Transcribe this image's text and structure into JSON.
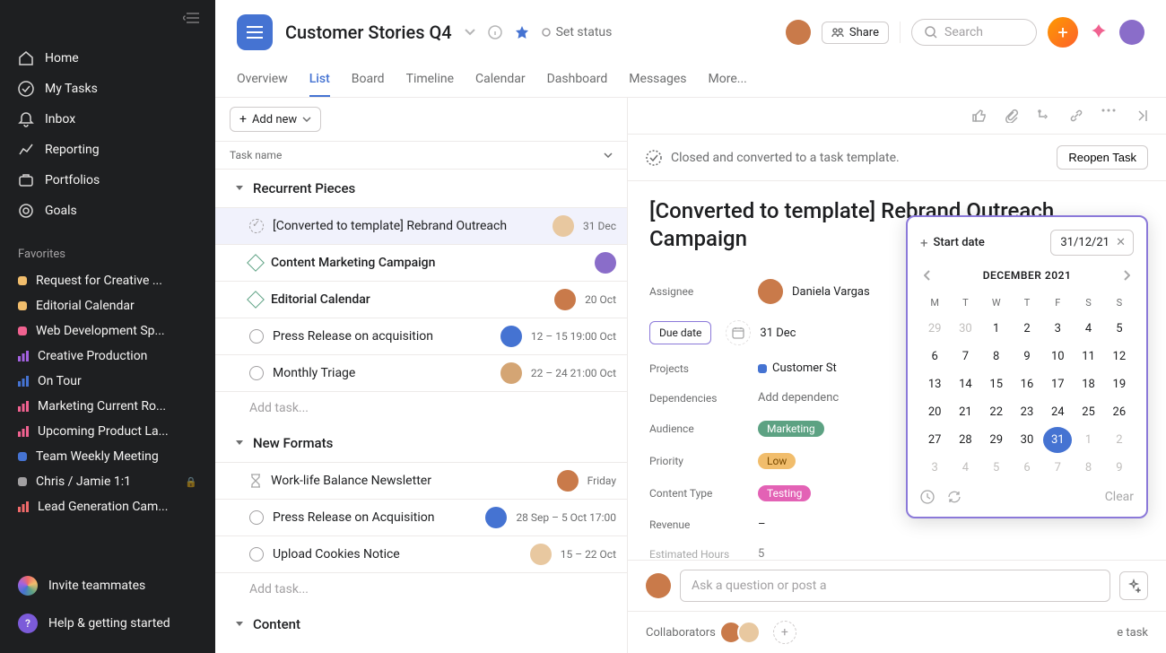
{
  "sidebar": {
    "nav": [
      {
        "icon": "home",
        "label": "Home"
      },
      {
        "icon": "check",
        "label": "My Tasks"
      },
      {
        "icon": "bell",
        "label": "Inbox"
      },
      {
        "icon": "chart",
        "label": "Reporting"
      },
      {
        "icon": "briefcase",
        "label": "Portfolios"
      },
      {
        "icon": "target",
        "label": "Goals"
      }
    ],
    "favorites_label": "Favorites",
    "favorites": [
      {
        "color": "#f1bd6c",
        "label": "Request for Creative ..."
      },
      {
        "color": "#f1bd6c",
        "label": "Editorial Calendar"
      },
      {
        "color": "#f06290",
        "label": "Web Development Sp..."
      },
      {
        "type": "bars",
        "color": "#a362e0",
        "label": "Creative Production"
      },
      {
        "type": "bars",
        "color": "#4573d2",
        "label": "On Tour"
      },
      {
        "type": "bars",
        "color": "#f06290",
        "label": "Marketing Current Ro..."
      },
      {
        "type": "bars",
        "color": "#f06290",
        "label": "Upcoming Product La..."
      },
      {
        "color": "#4573d2",
        "label": "Team Weekly Meeting"
      },
      {
        "color": "#a2a0a2",
        "label": "Chris / Jamie 1:1",
        "locked": true
      },
      {
        "type": "bars",
        "color": "#f06a6a",
        "label": "Lead Generation Cam..."
      }
    ],
    "invite": "Invite teammates",
    "help": "Help & getting started"
  },
  "header": {
    "title": "Customer Stories Q4",
    "set_status": "Set status",
    "share": "Share",
    "search_placeholder": "Search",
    "tabs": [
      "Overview",
      "List",
      "Board",
      "Timeline",
      "Calendar",
      "Dashboard",
      "Messages",
      "More..."
    ],
    "active_tab": 1
  },
  "list": {
    "add_new": "Add new",
    "column_header": "Task name",
    "sections": [
      {
        "name": "Recurrent Pieces",
        "tasks": [
          {
            "icon": "template",
            "name": "[Converted to template] Rebrand Outreach",
            "avatar": "pale",
            "date": "31 Dec",
            "selected": true
          },
          {
            "icon": "diamond",
            "name": "Content Marketing Campaign",
            "bold": true,
            "avatar": "purple",
            "date": ""
          },
          {
            "icon": "diamond",
            "name": "Editorial Calendar",
            "bold": true,
            "avatar": "brown",
            "date": "20 Oct"
          },
          {
            "icon": "circle",
            "name": "Press Release on acquisition",
            "avatar": "blue",
            "date": "12 – 15 19:00 Oct"
          },
          {
            "icon": "circle",
            "name": "Monthly Triage",
            "avatar": "tan",
            "date": "22 – 24 21:00 Oct"
          }
        ],
        "add_label": "Add task..."
      },
      {
        "name": "New Formats",
        "tasks": [
          {
            "icon": "hourglass",
            "name": "Work-life Balance Newsletter",
            "avatar": "brown",
            "date": "Friday"
          },
          {
            "icon": "circle",
            "name": "Press Release on Acquisition",
            "avatar": "blue",
            "date": "28 Sep – 5 Oct 17:00"
          },
          {
            "icon": "circle",
            "name": "Upload Cookies Notice",
            "avatar": "pale",
            "date": "15 – 22 Oct"
          }
        ],
        "add_label": "Add task..."
      },
      {
        "name": "Content",
        "tasks": []
      }
    ]
  },
  "detail": {
    "notice": "Closed and converted to a task template.",
    "reopen": "Reopen Task",
    "title": "[Converted to template] Rebrand Outreach Campaign",
    "fields": {
      "assignee_label": "Assignee",
      "assignee": "Daniela Vargas",
      "due_date_label": "Due date",
      "due_date": "31 Dec",
      "projects_label": "Projects",
      "project": "Customer St",
      "dependencies_label": "Dependencies",
      "dependencies": "Add dependenc",
      "audience_label": "Audience",
      "audience": "Marketing",
      "priority_label": "Priority",
      "priority": "Low",
      "content_type_label": "Content Type",
      "content_type": "Testing",
      "revenue_label": "Revenue",
      "revenue": "–",
      "estimated_hours_label": "Estimated Hours",
      "estimated_hours": "5"
    },
    "comment_placeholder": "Ask a question or post a",
    "collaborators_label": "Collaborators",
    "leave_task": "e task"
  },
  "datepicker": {
    "start_date": "Start date",
    "value": "31/12/21",
    "month_label": "DECEMBER 2021",
    "dow": [
      "M",
      "T",
      "W",
      "T",
      "F",
      "S",
      "S"
    ],
    "weeks": [
      [
        {
          "d": 29,
          "o": true
        },
        {
          "d": 30,
          "o": true
        },
        {
          "d": 1
        },
        {
          "d": 2
        },
        {
          "d": 3
        },
        {
          "d": 4
        },
        {
          "d": 5
        }
      ],
      [
        {
          "d": 6
        },
        {
          "d": 7
        },
        {
          "d": 8
        },
        {
          "d": 9
        },
        {
          "d": 10
        },
        {
          "d": 11
        },
        {
          "d": 12
        }
      ],
      [
        {
          "d": 13
        },
        {
          "d": 14
        },
        {
          "d": 15
        },
        {
          "d": 16
        },
        {
          "d": 17
        },
        {
          "d": 18
        },
        {
          "d": 19
        }
      ],
      [
        {
          "d": 20
        },
        {
          "d": 21
        },
        {
          "d": 22
        },
        {
          "d": 23
        },
        {
          "d": 24
        },
        {
          "d": 25
        },
        {
          "d": 26
        }
      ],
      [
        {
          "d": 27
        },
        {
          "d": 28
        },
        {
          "d": 29
        },
        {
          "d": 30
        },
        {
          "d": 31,
          "sel": true
        },
        {
          "d": 1,
          "o": true
        },
        {
          "d": 2,
          "o": true
        }
      ],
      [
        {
          "d": 3,
          "o": true
        },
        {
          "d": 4,
          "o": true
        },
        {
          "d": 5,
          "o": true
        },
        {
          "d": 6,
          "o": true
        },
        {
          "d": 7,
          "o": true
        },
        {
          "d": 8,
          "o": true
        },
        {
          "d": 9,
          "o": true
        }
      ]
    ],
    "clear": "Clear"
  }
}
